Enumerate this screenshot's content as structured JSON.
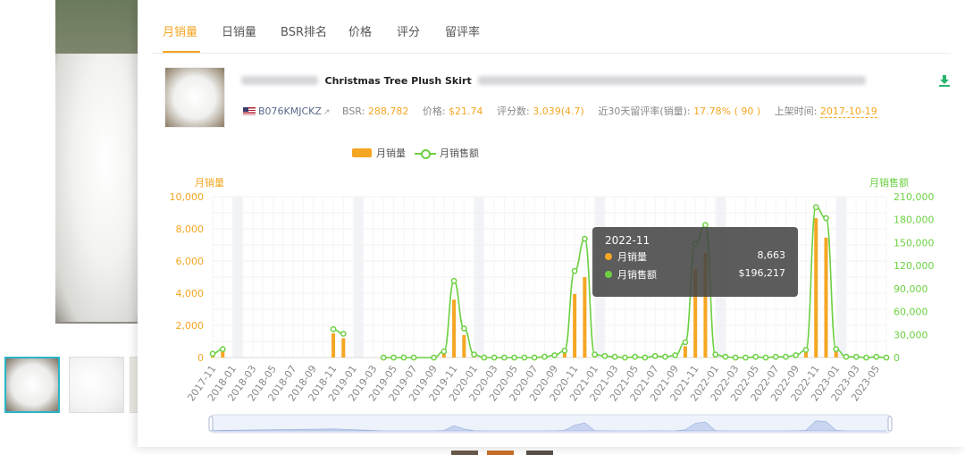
{
  "tabs": [
    "月销量",
    "日销量",
    "BSR排名",
    "价格",
    "评分",
    "留评率"
  ],
  "active_tab": 0,
  "product": {
    "title": "Christmas Tree Plush Skirt",
    "asin": "B076KMJCKZ",
    "bsr_label": "BSR:",
    "bsr": "288,782",
    "price_label": "价格:",
    "price": "$21.74",
    "rating_label": "评分数:",
    "rating": "3,039(4.7)",
    "review_rate_label": "近30天留评率(销量):",
    "review_rate": "17.78% ( 90 )",
    "launch_label": "上架时间:",
    "launch_date": "2017-10-19"
  },
  "legend": {
    "bar": "月销量",
    "line": "月销售额"
  },
  "axis_titles": {
    "left": "月销量",
    "right": "月销售额"
  },
  "tooltip": {
    "title": "2022-11",
    "rows": [
      {
        "label": "月销量",
        "value": "8,663",
        "color": "#f5a623"
      },
      {
        "label": "月销售额",
        "value": "$196,217",
        "color": "#6dd043"
      }
    ]
  },
  "colors": {
    "bar": "#f5a623",
    "line": "#6dd043",
    "accent": "#f5a623",
    "download": "#29b46e"
  },
  "chart_data": {
    "type": "bar+line",
    "x_ticks": [
      "2017-11",
      "2018-01",
      "2018-03",
      "2018-05",
      "2018-07",
      "2018-09",
      "2018-11",
      "2019-01",
      "2019-03",
      "2019-05",
      "2019-07",
      "2019-09",
      "2019-11",
      "2020-01",
      "2020-03",
      "2020-05",
      "2020-07",
      "2020-09",
      "2020-11",
      "2021-01",
      "2021-03",
      "2021-05",
      "2021-07",
      "2021-09",
      "2021-11",
      "2022-01",
      "2022-03",
      "2022-05",
      "2022-07",
      "2022-09",
      "2022-11",
      "2023-01",
      "2023-03",
      "2023-05"
    ],
    "left_axis": {
      "label": "月销量",
      "range": [
        0,
        10000
      ],
      "ticks": [
        "0",
        "2,000",
        "4,000",
        "6,000",
        "8,000",
        "10,000"
      ]
    },
    "right_axis": {
      "label": "月销售额",
      "range": [
        0,
        210000
      ],
      "ticks": [
        "0",
        "30,000",
        "60,000",
        "90,000",
        "120,000",
        "150,000",
        "180,000",
        "210,000"
      ]
    },
    "series": [
      {
        "name": "月销量",
        "type": "bar",
        "axis": "left",
        "values": [
          [
            "2017-11",
            250
          ],
          [
            "2017-12",
            450
          ],
          [
            "2018-11",
            1500
          ],
          [
            "2018-12",
            1200
          ],
          [
            "2019-10",
            300
          ],
          [
            "2019-11",
            3600
          ],
          [
            "2019-12",
            1400
          ],
          [
            "2020-01",
            300
          ],
          [
            "2020-09",
            150
          ],
          [
            "2020-10",
            400
          ],
          [
            "2020-11",
            3950
          ],
          [
            "2020-12",
            5000
          ],
          [
            "2021-01",
            300
          ],
          [
            "2021-09",
            150
          ],
          [
            "2021-10",
            700
          ],
          [
            "2021-11",
            5500
          ],
          [
            "2021-12",
            6500
          ],
          [
            "2022-01",
            300
          ],
          [
            "2022-09",
            150
          ],
          [
            "2022-10",
            500
          ],
          [
            "2022-11",
            8663
          ],
          [
            "2022-12",
            7450
          ],
          [
            "2023-01",
            500
          ],
          [
            "2023-02",
            100
          ]
        ]
      },
      {
        "name": "月销售额",
        "type": "line",
        "axis": "right",
        "segments": [
          [
            [
              "2017-11",
              5000
            ],
            [
              "2017-12",
              11000
            ]
          ],
          [
            [
              "2018-11",
              37000
            ],
            [
              "2018-12",
              31000
            ]
          ],
          [
            [
              "2019-04",
              0
            ],
            [
              "2019-05",
              0
            ],
            [
              "2019-06",
              0
            ],
            [
              "2019-07",
              0
            ],
            [
              "2019-09",
              0
            ],
            [
              "2019-10",
              8000
            ],
            [
              "2019-11",
              100000
            ],
            [
              "2019-12",
              38000
            ],
            [
              "2020-01",
              4000
            ],
            [
              "2020-02",
              0
            ],
            [
              "2020-03",
              0
            ],
            [
              "2020-04",
              0
            ],
            [
              "2020-05",
              0
            ],
            [
              "2020-06",
              0
            ],
            [
              "2020-07",
              0
            ],
            [
              "2020-08",
              1000
            ],
            [
              "2020-09",
              3000
            ],
            [
              "2020-10",
              9000
            ],
            [
              "2020-11",
              113000
            ],
            [
              "2020-12",
              155000
            ],
            [
              "2021-01",
              4000
            ],
            [
              "2021-02",
              2000
            ],
            [
              "2021-03",
              1000
            ],
            [
              "2021-04",
              0
            ],
            [
              "2021-05",
              1000
            ],
            [
              "2021-06",
              0
            ],
            [
              "2021-07",
              2000
            ],
            [
              "2021-08",
              1000
            ],
            [
              "2021-09",
              3000
            ],
            [
              "2021-10",
              20000
            ],
            [
              "2021-11",
              148000
            ],
            [
              "2021-12",
              173000
            ],
            [
              "2022-01",
              4000
            ],
            [
              "2022-02",
              1000
            ],
            [
              "2022-03",
              0
            ],
            [
              "2022-04",
              0
            ],
            [
              "2022-05",
              1000
            ],
            [
              "2022-06",
              0
            ],
            [
              "2022-07",
              1000
            ],
            [
              "2022-08",
              1000
            ],
            [
              "2022-09",
              3000
            ],
            [
              "2022-10",
              10000
            ],
            [
              "2022-11",
              196217
            ],
            [
              "2022-12",
              182000
            ],
            [
              "2023-01",
              11000
            ],
            [
              "2023-02",
              1000
            ],
            [
              "2023-03",
              1000
            ],
            [
              "2023-04",
              0
            ],
            [
              "2023-05",
              1000
            ],
            [
              "2023-06",
              0
            ]
          ]
        ]
      }
    ],
    "grid": true,
    "legend_position": "top-center",
    "tooltip_month": "2022-11"
  }
}
